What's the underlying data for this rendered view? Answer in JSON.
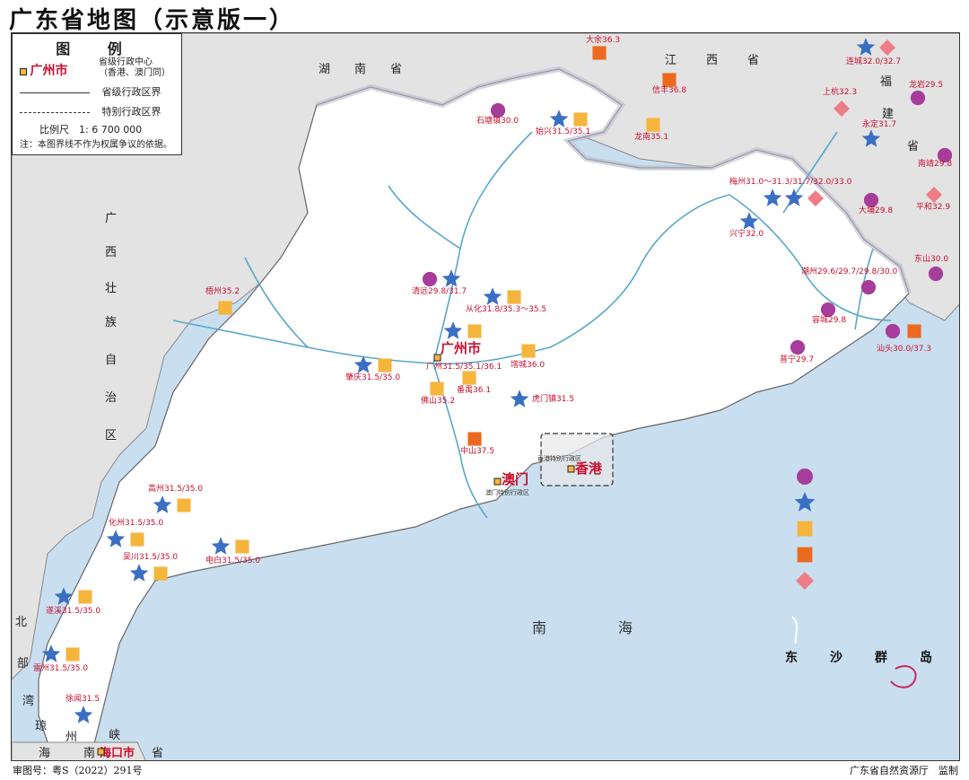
{
  "title": "广东省地图（示意版一）",
  "legend": {
    "title": "图 例",
    "capital_sample": "广州市",
    "capital_desc_1": "省级行政中心",
    "capital_desc_2": "（香港、澳门同）",
    "boundary_province": "省级行政区界",
    "boundary_special": "特别行政区界",
    "scale": "比例尺　1: 6 700 000",
    "note": "注：本图界线不作为权属争议的依据。"
  },
  "footer": {
    "approval": "审图号：粤S（2022）291号",
    "supervisor": "广东省自然资源厅　监制"
  },
  "neighbors": {
    "hunan": [
      "湖",
      "南",
      "省"
    ],
    "jiangxi": [
      "江",
      "西",
      "省"
    ],
    "fujian": [
      "福",
      "建",
      "省"
    ],
    "guangxi": [
      "广",
      "西",
      "壮",
      "族",
      "自",
      "治",
      "区"
    ],
    "hainan": [
      "琼",
      "州",
      "海",
      "峡"
    ],
    "beibu": [
      "北",
      "部",
      "湾"
    ],
    "haikou": "海口市",
    "hainan_sheng": [
      "南",
      "省"
    ]
  },
  "cities": {
    "guangzhou": "广州市",
    "macau": "澳门",
    "macau_sub": "澳门特别行政区",
    "hongkong": "香港",
    "hongkong_sub": "香港特别行政区"
  },
  "sea": [
    "南",
    "海"
  ],
  "islands": [
    "东",
    "沙",
    "群",
    "岛"
  ],
  "colors": {
    "land": "#ffffff",
    "neighbor": "#e3e3e3",
    "sea": "#c9dff0",
    "river": "#5aa7c9",
    "boundary": "#555555",
    "circle": "#a63d9b",
    "star": "#3a6fc4",
    "square_light": "#f5b53d",
    "square_dark": "#ec6a1f",
    "diamond": "#ef7d86",
    "label": "#c8102e"
  },
  "markers": [
    {
      "label": "大余36.3",
      "symbols": [
        "square_dark"
      ]
    },
    {
      "label": "信丰36.8",
      "symbols": [
        "square_dark"
      ]
    },
    {
      "label": "龙南35.1",
      "symbols": [
        "square_light"
      ]
    },
    {
      "label": "石塘镇30.0",
      "symbols": [
        "circle"
      ]
    },
    {
      "label": "始兴31.5/35.1",
      "symbols": [
        "star",
        "square_light"
      ]
    },
    {
      "label": "连城32.0/32.7",
      "symbols": [
        "star",
        "diamond"
      ]
    },
    {
      "label": "龙岩29.5",
      "symbols": [
        "circle"
      ]
    },
    {
      "label": "上杭32.3",
      "symbols": [
        "diamond"
      ]
    },
    {
      "label": "永定31.7",
      "symbols": [
        "star"
      ]
    },
    {
      "label": "南靖29.8",
      "symbols": [
        "circle"
      ]
    },
    {
      "label": "梅州31.0～31.3/31.7/32.0/33.0",
      "symbols": [
        "star",
        "star",
        "diamond"
      ]
    },
    {
      "label": "平和32.9",
      "symbols": [
        "diamond"
      ]
    },
    {
      "label": "大埔29.8",
      "symbols": [
        "circle"
      ]
    },
    {
      "label": "兴宁32.0",
      "symbols": [
        "star"
      ]
    },
    {
      "label": "东山30.0",
      "symbols": [
        "circle"
      ]
    },
    {
      "label": "潮州29.6/29.7/29.8/30.0",
      "symbols": [
        "circle"
      ]
    },
    {
      "label": "容城29.8",
      "symbols": [
        "circle"
      ]
    },
    {
      "label": "汕头30.0/37.3",
      "symbols": [
        "circle",
        "square_dark"
      ]
    },
    {
      "label": "普宁29.7",
      "symbols": [
        "circle"
      ]
    },
    {
      "label": "清远29.8/31.7",
      "symbols": [
        "circle",
        "star"
      ]
    },
    {
      "label": "从化31.8/35.3～35.5",
      "symbols": [
        "star",
        "square_light"
      ]
    },
    {
      "label": "梧州35.2",
      "symbols": [
        "square_light"
      ]
    },
    {
      "label": "广州31.5/35.1/36.1",
      "symbols": [
        "star",
        "square_light"
      ]
    },
    {
      "label": "增城36.0",
      "symbols": [
        "square_light"
      ]
    },
    {
      "label": "肇庆31.5/35.0",
      "symbols": [
        "star",
        "square_light"
      ]
    },
    {
      "label": "番禺36.1",
      "symbols": [
        "square_light"
      ]
    },
    {
      "label": "佛山35.2",
      "symbols": [
        "square_light"
      ]
    },
    {
      "label": "虎门镇31.5",
      "symbols": [
        "star"
      ]
    },
    {
      "label": "中山37.5",
      "symbols": [
        "square_dark"
      ]
    },
    {
      "label": "高州31.5/35.0",
      "symbols": [
        "star",
        "square_light"
      ]
    },
    {
      "label": "化州31.5/35.0",
      "symbols": [
        "star",
        "square_light"
      ]
    },
    {
      "label": "电白31.5/35.0",
      "symbols": [
        "star",
        "square_light"
      ]
    },
    {
      "label": "吴川31.5/35.0",
      "symbols": [
        "star",
        "square_light"
      ]
    },
    {
      "label": "遂溪31.5/35.0",
      "symbols": [
        "star",
        "square_light"
      ]
    },
    {
      "label": "雷州31.5/35.0",
      "symbols": [
        "star",
        "square_light"
      ]
    },
    {
      "label": "徐闻31.5",
      "symbols": [
        "star"
      ]
    }
  ],
  "symbol_legend": [
    "circle",
    "star",
    "square_light",
    "square_dark",
    "diamond"
  ]
}
